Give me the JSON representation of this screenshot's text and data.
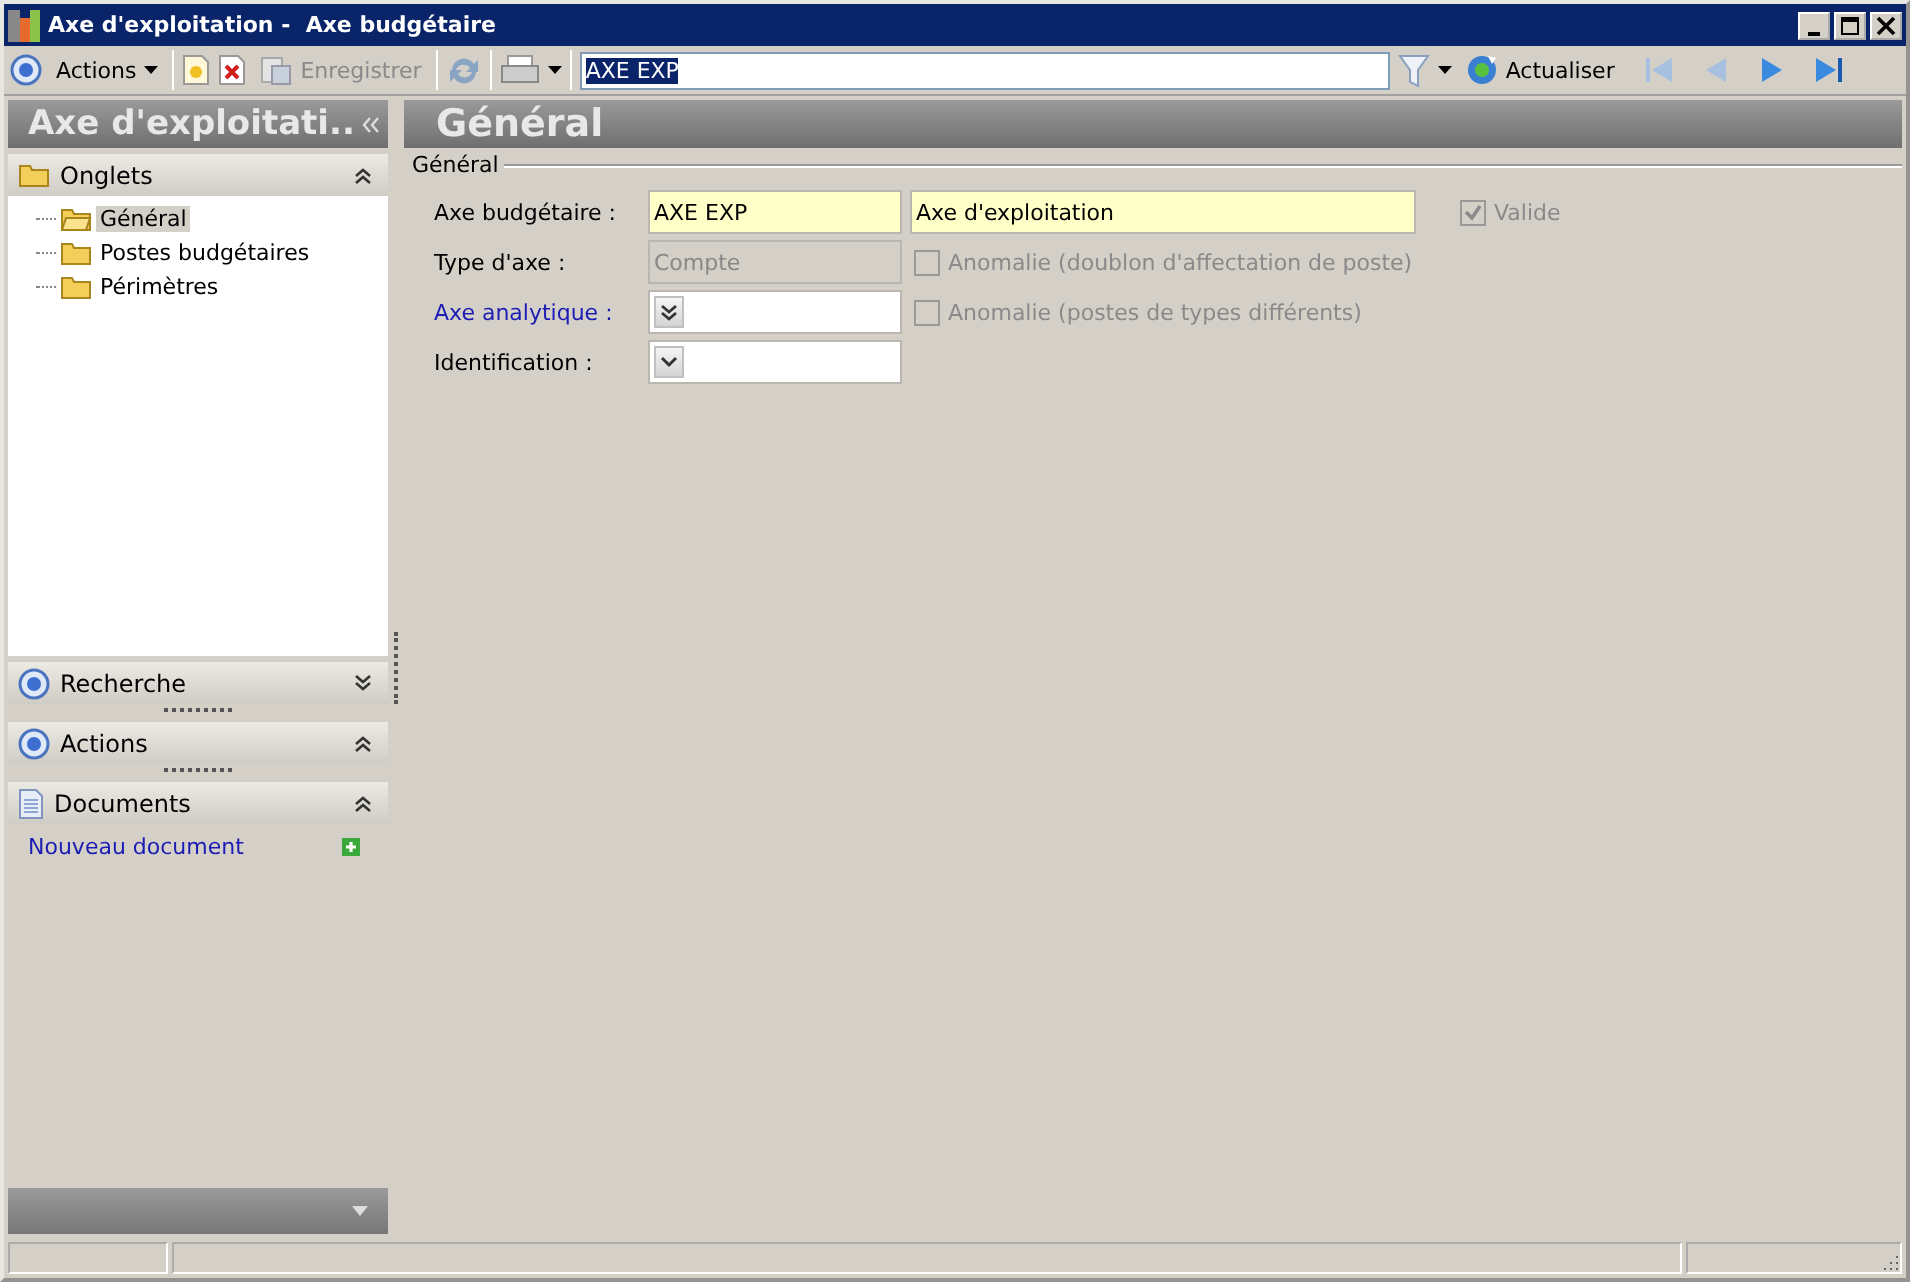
{
  "window": {
    "title": "Axe d'exploitation -  Axe budgétaire"
  },
  "toolbar": {
    "actions_label": "Actions",
    "save": {
      "label": "Enregistrer",
      "disabled": true
    },
    "search": {
      "value": "AXE EXP"
    },
    "refresh_label": "Actualiser"
  },
  "sidebar": {
    "title": "Axe d'exploitati..",
    "sections": [
      {
        "kind": "folder",
        "label": "Onglets",
        "expanded": true,
        "items": [
          {
            "label": "Général",
            "selected": true
          },
          {
            "label": "Postes budgétaires",
            "selected": false
          },
          {
            "label": "Périmètres",
            "selected": false
          }
        ]
      },
      {
        "kind": "radio",
        "label": "Recherche",
        "expanded": false
      },
      {
        "kind": "radio",
        "label": "Actions",
        "expanded": true
      },
      {
        "kind": "document",
        "label": "Documents",
        "expanded": true,
        "link": "Nouveau document"
      }
    ]
  },
  "content": {
    "title": "Général",
    "group_title": "Général",
    "rows": [
      {
        "label": "Axe budgétaire :",
        "link": false,
        "field": {
          "kind": "text",
          "value": "AXE EXP",
          "required": true,
          "disabled": false
        },
        "name_field": {
          "value": "Axe d'exploitation",
          "required": true
        },
        "checkbox": {
          "label": "Valide",
          "checked": true,
          "disabled": true
        }
      },
      {
        "label": "Type d'axe :",
        "link": false,
        "field": {
          "kind": "text",
          "value": "Compte",
          "required": false,
          "disabled": true
        },
        "checkbox": {
          "label": "Anomalie (doublon d'affectation de poste)",
          "checked": false,
          "disabled": true
        }
      },
      {
        "label": "Axe analytique :",
        "link": true,
        "field": {
          "kind": "lookup",
          "required": false,
          "disabled": false
        },
        "checkbox": {
          "label": "Anomalie (postes de types différents)",
          "checked": false,
          "disabled": true
        }
      },
      {
        "label": "Identification  :",
        "link": false,
        "field": {
          "kind": "select",
          "required": false,
          "disabled": false
        }
      }
    ]
  }
}
